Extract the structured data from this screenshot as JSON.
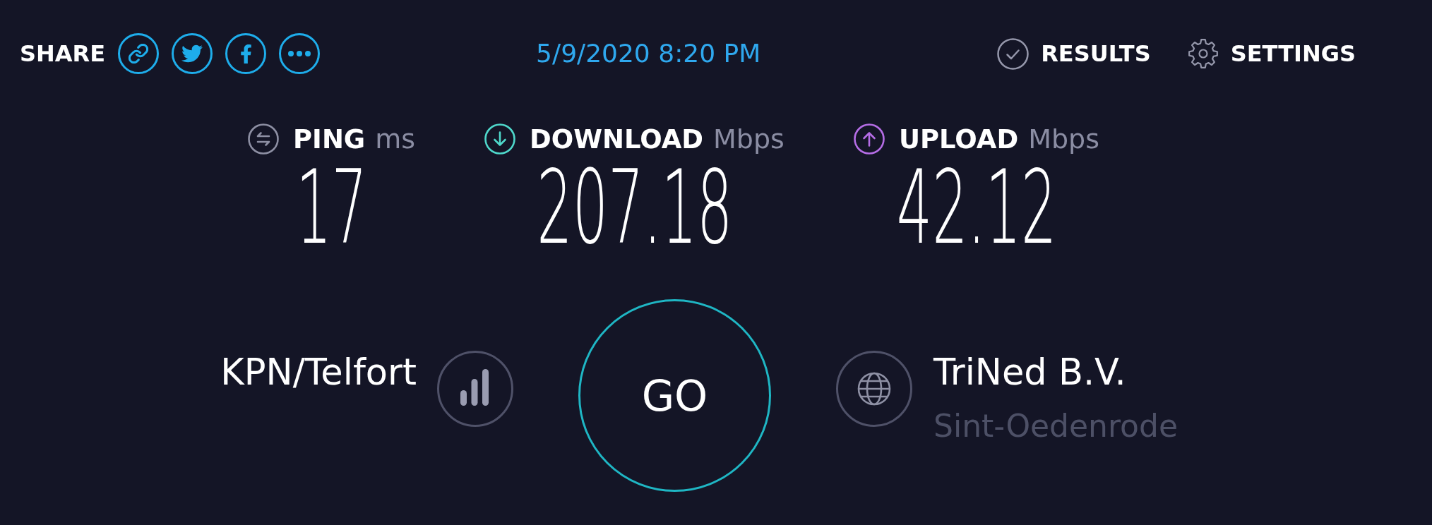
{
  "header": {
    "share_label": "SHARE",
    "timestamp": "5/9/2020 8:20 PM",
    "nav": [
      {
        "kind": "results",
        "label": "RESULTS"
      },
      {
        "kind": "settings",
        "label": "SETTINGS"
      }
    ]
  },
  "metrics": [
    {
      "kind": "ping",
      "label": "PING",
      "unit": "ms",
      "value": "17"
    },
    {
      "kind": "download",
      "label": "DOWNLOAD",
      "unit": "Mbps",
      "value": "207.18"
    },
    {
      "kind": "upload",
      "label": "UPLOAD",
      "unit": "Mbps",
      "value": "42.12"
    }
  ],
  "connection": {
    "isp": "KPN/Telfort",
    "start_button": "GO",
    "server": {
      "name": "TriNed B.V.",
      "location": "Sint-Oedenrode"
    }
  }
}
